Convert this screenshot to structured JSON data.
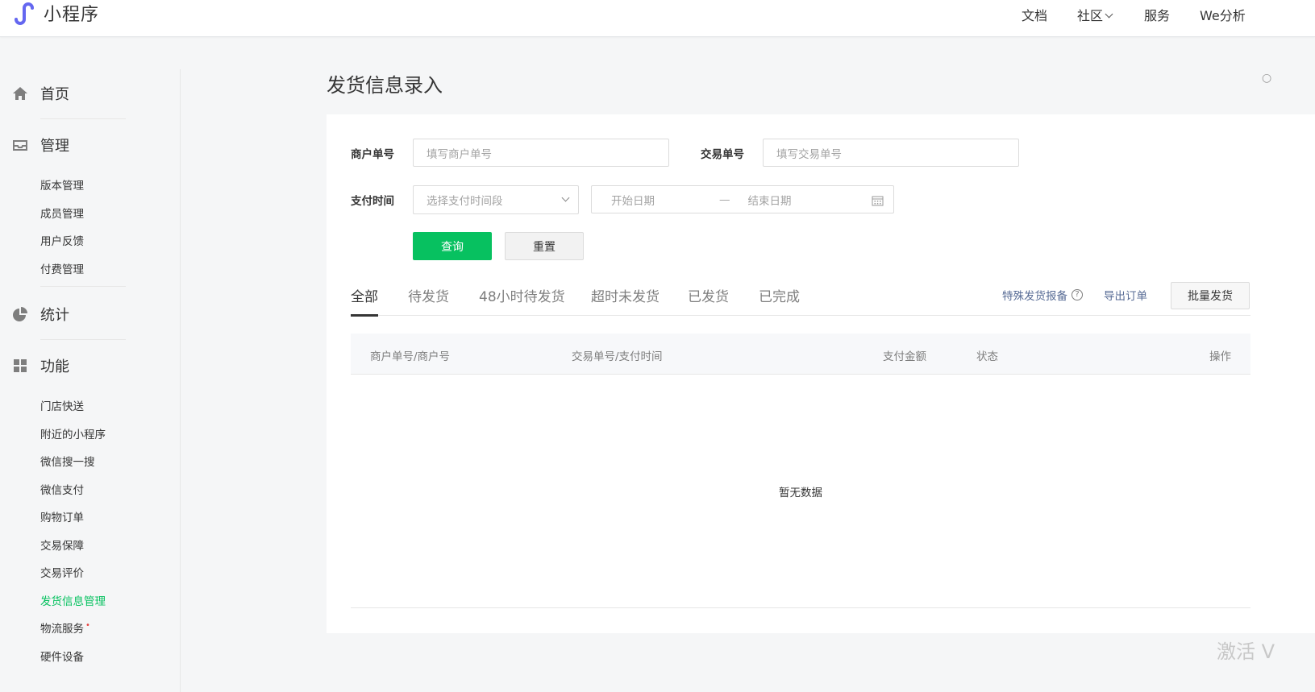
{
  "header": {
    "app_title": "小程序",
    "nav": [
      "文档",
      "社区",
      "服务",
      "We分析"
    ],
    "brand_color": "#6467f0"
  },
  "sidebar": {
    "home": "首页",
    "manage": {
      "title": "管理",
      "items": [
        "版本管理",
        "成员管理",
        "用户反馈",
        "付费管理"
      ]
    },
    "stats": "统计",
    "features": {
      "title": "功能",
      "items": [
        "门店快送",
        "附近的小程序",
        "微信搜一搜",
        "微信支付",
        "购物订单",
        "交易保障",
        "交易评价",
        "发货信息管理",
        "物流服务",
        "硬件设备"
      ],
      "active_item": "发货信息管理",
      "new_badge": "•"
    },
    "active_color": "#07c160"
  },
  "main": {
    "title": "发货信息录入",
    "form": {
      "merchant_no_label": "商户单号",
      "merchant_no_placeholder": "填写商户单号",
      "trade_no_label": "交易单号",
      "trade_no_placeholder": "填写交易单号",
      "pay_time_label": "支付时间",
      "pay_time_select_placeholder": "选择支付时间段",
      "start_date_placeholder": "开始日期",
      "date_separator": "—",
      "end_date_placeholder": "结束日期",
      "query_button": "查询",
      "reset_button": "重置"
    },
    "tabs": [
      "全部",
      "待发货",
      "48小时待发货",
      "超时未发货",
      "已发货",
      "已完成"
    ],
    "active_tab": "全部",
    "actions": {
      "special_report": "特殊发货报备",
      "export_orders": "导出订单",
      "batch_ship": "批量发货"
    },
    "table": {
      "columns": [
        "商户单号/商户号",
        "交易单号/支付时间",
        "支付金额",
        "状态",
        "操作"
      ],
      "rows": [],
      "empty_text": "暂无数据"
    }
  },
  "watermark": "激活 V"
}
